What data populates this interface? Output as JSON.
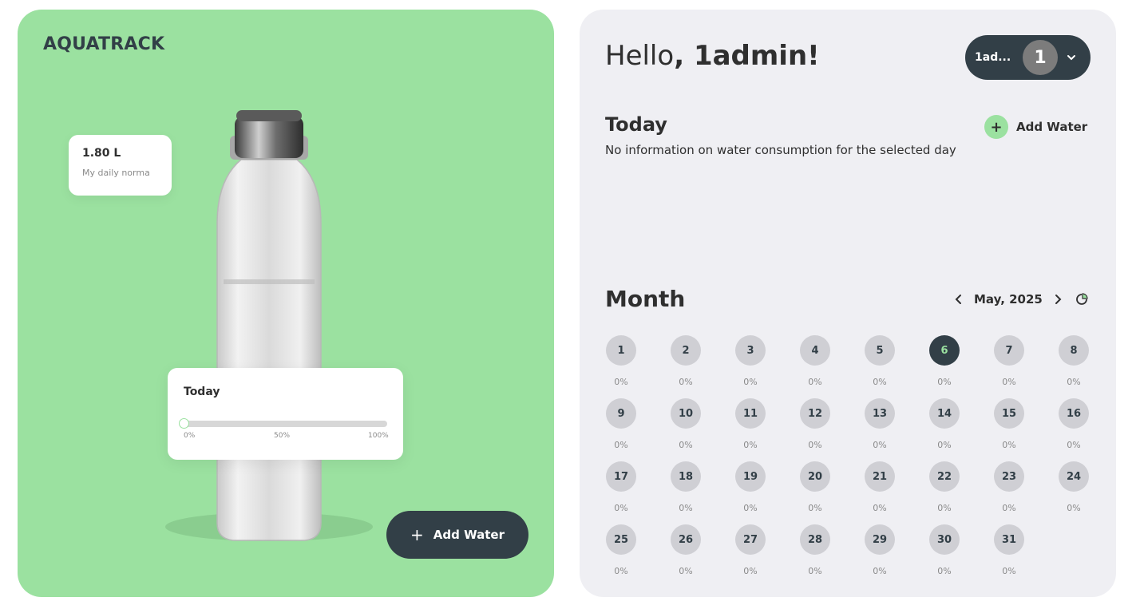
{
  "app": {
    "title": "AQUATRACK"
  },
  "left": {
    "daily_norma_value": "1.80 L",
    "daily_norma_label": "My daily norma",
    "today_title": "Today",
    "progress_ticks": [
      "0%",
      "50%",
      "100%"
    ],
    "progress_fraction": 0,
    "add_water_label": "Add Water"
  },
  "header": {
    "greeting_prefix": "Hello",
    "greeting_name": ", 1admin!",
    "user_short": "1ad...",
    "avatar_letter": "1"
  },
  "today": {
    "title": "Today",
    "add_water_label": "Add Water",
    "empty_message": "No information on water consumption for the selected day"
  },
  "month": {
    "title": "Month",
    "label": "May, 2025",
    "selected_day": 6,
    "days": [
      {
        "n": "1",
        "p": "0%"
      },
      {
        "n": "2",
        "p": "0%"
      },
      {
        "n": "3",
        "p": "0%"
      },
      {
        "n": "4",
        "p": "0%"
      },
      {
        "n": "5",
        "p": "0%"
      },
      {
        "n": "6",
        "p": "0%"
      },
      {
        "n": "7",
        "p": "0%"
      },
      {
        "n": "8",
        "p": "0%"
      },
      {
        "n": "9",
        "p": "0%"
      },
      {
        "n": "10",
        "p": "0%"
      },
      {
        "n": "11",
        "p": "0%"
      },
      {
        "n": "12",
        "p": "0%"
      },
      {
        "n": "13",
        "p": "0%"
      },
      {
        "n": "14",
        "p": "0%"
      },
      {
        "n": "15",
        "p": "0%"
      },
      {
        "n": "16",
        "p": "0%"
      },
      {
        "n": "17",
        "p": "0%"
      },
      {
        "n": "18",
        "p": "0%"
      },
      {
        "n": "19",
        "p": "0%"
      },
      {
        "n": "20",
        "p": "0%"
      },
      {
        "n": "21",
        "p": "0%"
      },
      {
        "n": "22",
        "p": "0%"
      },
      {
        "n": "23",
        "p": "0%"
      },
      {
        "n": "24",
        "p": "0%"
      },
      {
        "n": "25",
        "p": "0%"
      },
      {
        "n": "26",
        "p": "0%"
      },
      {
        "n": "27",
        "p": "0%"
      },
      {
        "n": "28",
        "p": "0%"
      },
      {
        "n": "29",
        "p": "0%"
      },
      {
        "n": "30",
        "p": "0%"
      },
      {
        "n": "31",
        "p": "0%"
      }
    ]
  },
  "colors": {
    "accent": "#9be1a0",
    "dark": "#323f47",
    "panel": "#efeff3"
  },
  "icons": [
    "plus-icon",
    "chevron-down-icon",
    "chevron-left-icon",
    "chevron-right-icon",
    "pie-chart-icon",
    "bottle-illustration"
  ]
}
